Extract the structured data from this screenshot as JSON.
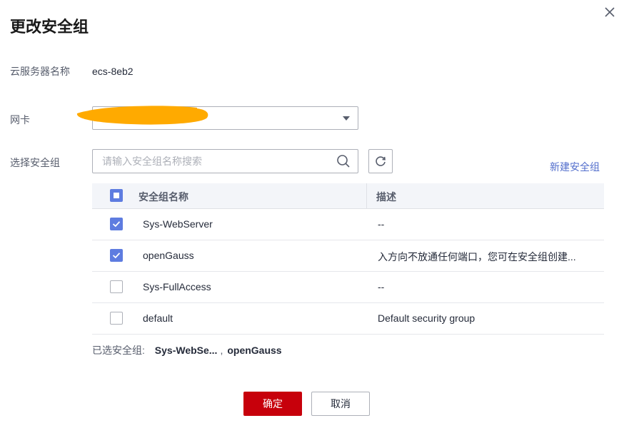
{
  "dialog": {
    "title": "更改安全组"
  },
  "server": {
    "label": "云服务器名称",
    "value": "ecs-8eb2"
  },
  "nic": {
    "label": "网卡",
    "value": ""
  },
  "security_group": {
    "label": "选择安全组",
    "search_placeholder": "请输入安全组名称搜索",
    "new_link": "新建安全组"
  },
  "table": {
    "columns": [
      "安全组名称",
      "描述"
    ],
    "rows": [
      {
        "name": "Sys-WebServer",
        "description": "--",
        "checked": true
      },
      {
        "name": "openGauss",
        "description": "入方向不放通任何端口，您可在安全组创建...",
        "checked": true
      },
      {
        "name": "Sys-FullAccess",
        "description": "--",
        "checked": false
      },
      {
        "name": "default",
        "description": "Default security group",
        "checked": false
      }
    ]
  },
  "selected": {
    "label": "已选安全组:",
    "items": [
      "Sys-WebSe...",
      "openGauss"
    ],
    "separator": ","
  },
  "buttons": {
    "confirm": "确定",
    "cancel": "取消"
  },
  "colors": {
    "primary": "#c7000b",
    "checkbox": "#5e7ce0",
    "link": "#526ecc",
    "redaction": "#ffaa00"
  }
}
